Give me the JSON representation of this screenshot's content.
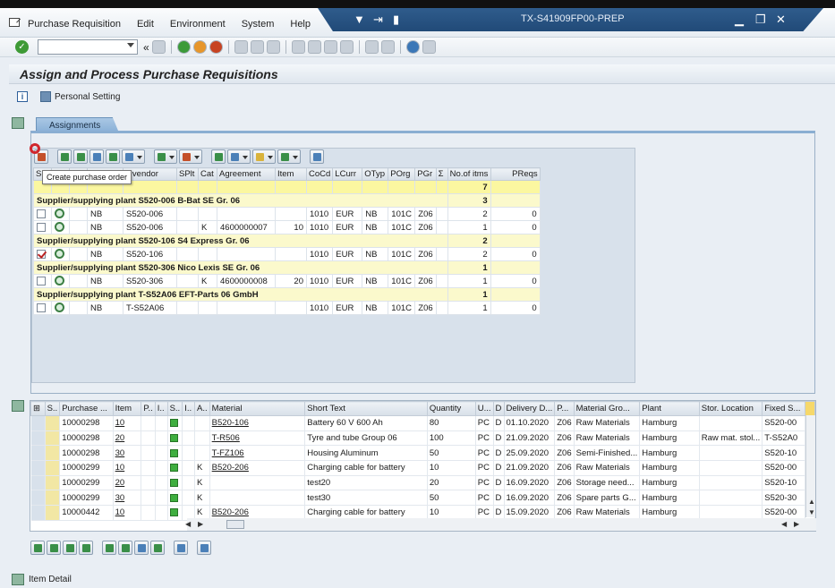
{
  "window": {
    "system_id": "TX-S41909FP00-PREP"
  },
  "menu": {
    "items": [
      "Purchase Requisition",
      "Edit",
      "Environment",
      "System",
      "Help"
    ]
  },
  "page": {
    "title": "Assign and Process Purchase Requisitions",
    "personal_setting": "Personal Setting",
    "tab_assignments": "Assignments",
    "item_detail": "Item Detail"
  },
  "tooltip": "Create purchase order",
  "assign_grid": {
    "columns": [
      "S",
      "",
      "",
      "d vendor",
      "SPlt",
      "Cat",
      "Agreement",
      "Item",
      "CoCd",
      "LCurr",
      "OTyp",
      "POrg",
      "PGr",
      "Σ",
      "No.of itms",
      "PReqs"
    ],
    "total_row": {
      "no_items": "7"
    },
    "groups": [
      {
        "label": "Supplier/supplying plant S520-006 B-Bat SE Gr. 06",
        "count": "3",
        "rows": [
          {
            "checked": false,
            "doc": "NB",
            "vendor": "S520-006",
            "cat": "",
            "agreement": "",
            "item": "",
            "cocd": "1010",
            "curr": "EUR",
            "otyp": "NB",
            "porg": "101C",
            "pgr": "Z06",
            "noitms": "2",
            "preqs": "0"
          },
          {
            "checked": false,
            "doc": "NB",
            "vendor": "S520-006",
            "cat": "K",
            "agreement": "4600000007",
            "item": "10",
            "cocd": "1010",
            "curr": "EUR",
            "otyp": "NB",
            "porg": "101C",
            "pgr": "Z06",
            "noitms": "1",
            "preqs": "0"
          }
        ]
      },
      {
        "label": "Supplier/supplying plant S520-106 S4 Express Gr. 06",
        "count": "2",
        "rows": [
          {
            "checked": true,
            "doc": "NB",
            "vendor": "S520-106",
            "cat": "",
            "agreement": "",
            "item": "",
            "cocd": "1010",
            "curr": "EUR",
            "otyp": "NB",
            "porg": "101C",
            "pgr": "Z06",
            "noitms": "2",
            "preqs": "0"
          }
        ]
      },
      {
        "label": "Supplier/supplying plant S520-306 Nico Lexis SE Gr. 06",
        "count": "1",
        "rows": [
          {
            "checked": false,
            "doc": "NB",
            "vendor": "S520-306",
            "cat": "K",
            "agreement": "4600000008",
            "item": "20",
            "cocd": "1010",
            "curr": "EUR",
            "otyp": "NB",
            "porg": "101C",
            "pgr": "Z06",
            "noitms": "1",
            "preqs": "0"
          }
        ]
      },
      {
        "label": "Supplier/supplying plant T-S52A06 EFT-Parts 06 GmbH",
        "count": "1",
        "rows": [
          {
            "checked": false,
            "doc": "NB",
            "vendor": "T-S52A06",
            "cat": "",
            "agreement": "",
            "item": "",
            "cocd": "1010",
            "curr": "EUR",
            "otyp": "NB",
            "porg": "101C",
            "pgr": "Z06",
            "noitms": "1",
            "preqs": "0"
          }
        ]
      }
    ]
  },
  "items_grid": {
    "columns": [
      "S..",
      "Purchase ...",
      "Item",
      "P..",
      "I..",
      "S..",
      "I..",
      "A..",
      "Material",
      "Short Text",
      "Quantity",
      "U...",
      "D",
      "Delivery D...",
      "P...",
      "Material Gro...",
      "Plant",
      "Stor. Location",
      "Fixed S..."
    ],
    "rows": [
      {
        "pr": "10000298",
        "item": "10",
        "acct": "",
        "material": "B520-106",
        "text": "Battery 60 V 600 Ah",
        "qty": "80",
        "unit": "PC",
        "d": "D",
        "date": "01.10.2020",
        "pgr": "Z06",
        "matgrp": "Raw Materials",
        "plant": "Hamburg",
        "sloc": "",
        "fixed": "S520-00"
      },
      {
        "pr": "10000298",
        "item": "20",
        "acct": "",
        "material": "T-R506",
        "text": "Tyre and tube Group 06",
        "qty": "100",
        "unit": "PC",
        "d": "D",
        "date": "21.09.2020",
        "pgr": "Z06",
        "matgrp": "Raw Materials",
        "plant": "Hamburg",
        "sloc": "Raw mat. stol...",
        "fixed": "T-S52A0"
      },
      {
        "pr": "10000298",
        "item": "30",
        "acct": "",
        "material": "T-FZ106",
        "text": "Housing Aluminum",
        "qty": "50",
        "unit": "PC",
        "d": "D",
        "date": "25.09.2020",
        "pgr": "Z06",
        "matgrp": "Semi-Finished...",
        "plant": "Hamburg",
        "sloc": "",
        "fixed": "S520-10"
      },
      {
        "pr": "10000299",
        "item": "10",
        "acct": "K",
        "material": "B520-206",
        "text": "Charging cable for battery",
        "qty": "10",
        "unit": "PC",
        "d": "D",
        "date": "21.09.2020",
        "pgr": "Z06",
        "matgrp": "Raw Materials",
        "plant": "Hamburg",
        "sloc": "",
        "fixed": "S520-00"
      },
      {
        "pr": "10000299",
        "item": "20",
        "acct": "K",
        "material": "",
        "text": "test20",
        "qty": "20",
        "unit": "PC",
        "d": "D",
        "date": "16.09.2020",
        "pgr": "Z06",
        "matgrp": "Storage need...",
        "plant": "Hamburg",
        "sloc": "",
        "fixed": "S520-10"
      },
      {
        "pr": "10000299",
        "item": "30",
        "acct": "K",
        "material": "",
        "text": "test30",
        "qty": "50",
        "unit": "PC",
        "d": "D",
        "date": "16.09.2020",
        "pgr": "Z06",
        "matgrp": "Spare parts G...",
        "plant": "Hamburg",
        "sloc": "",
        "fixed": "S520-30"
      },
      {
        "pr": "10000442",
        "item": "10",
        "acct": "K",
        "material": "B520-206",
        "text": "Charging cable for battery",
        "qty": "10",
        "unit": "PC",
        "d": "D",
        "date": "15.09.2020",
        "pgr": "Z06",
        "matgrp": "Raw Materials",
        "plant": "Hamburg",
        "sloc": "",
        "fixed": "S520-00"
      }
    ]
  }
}
